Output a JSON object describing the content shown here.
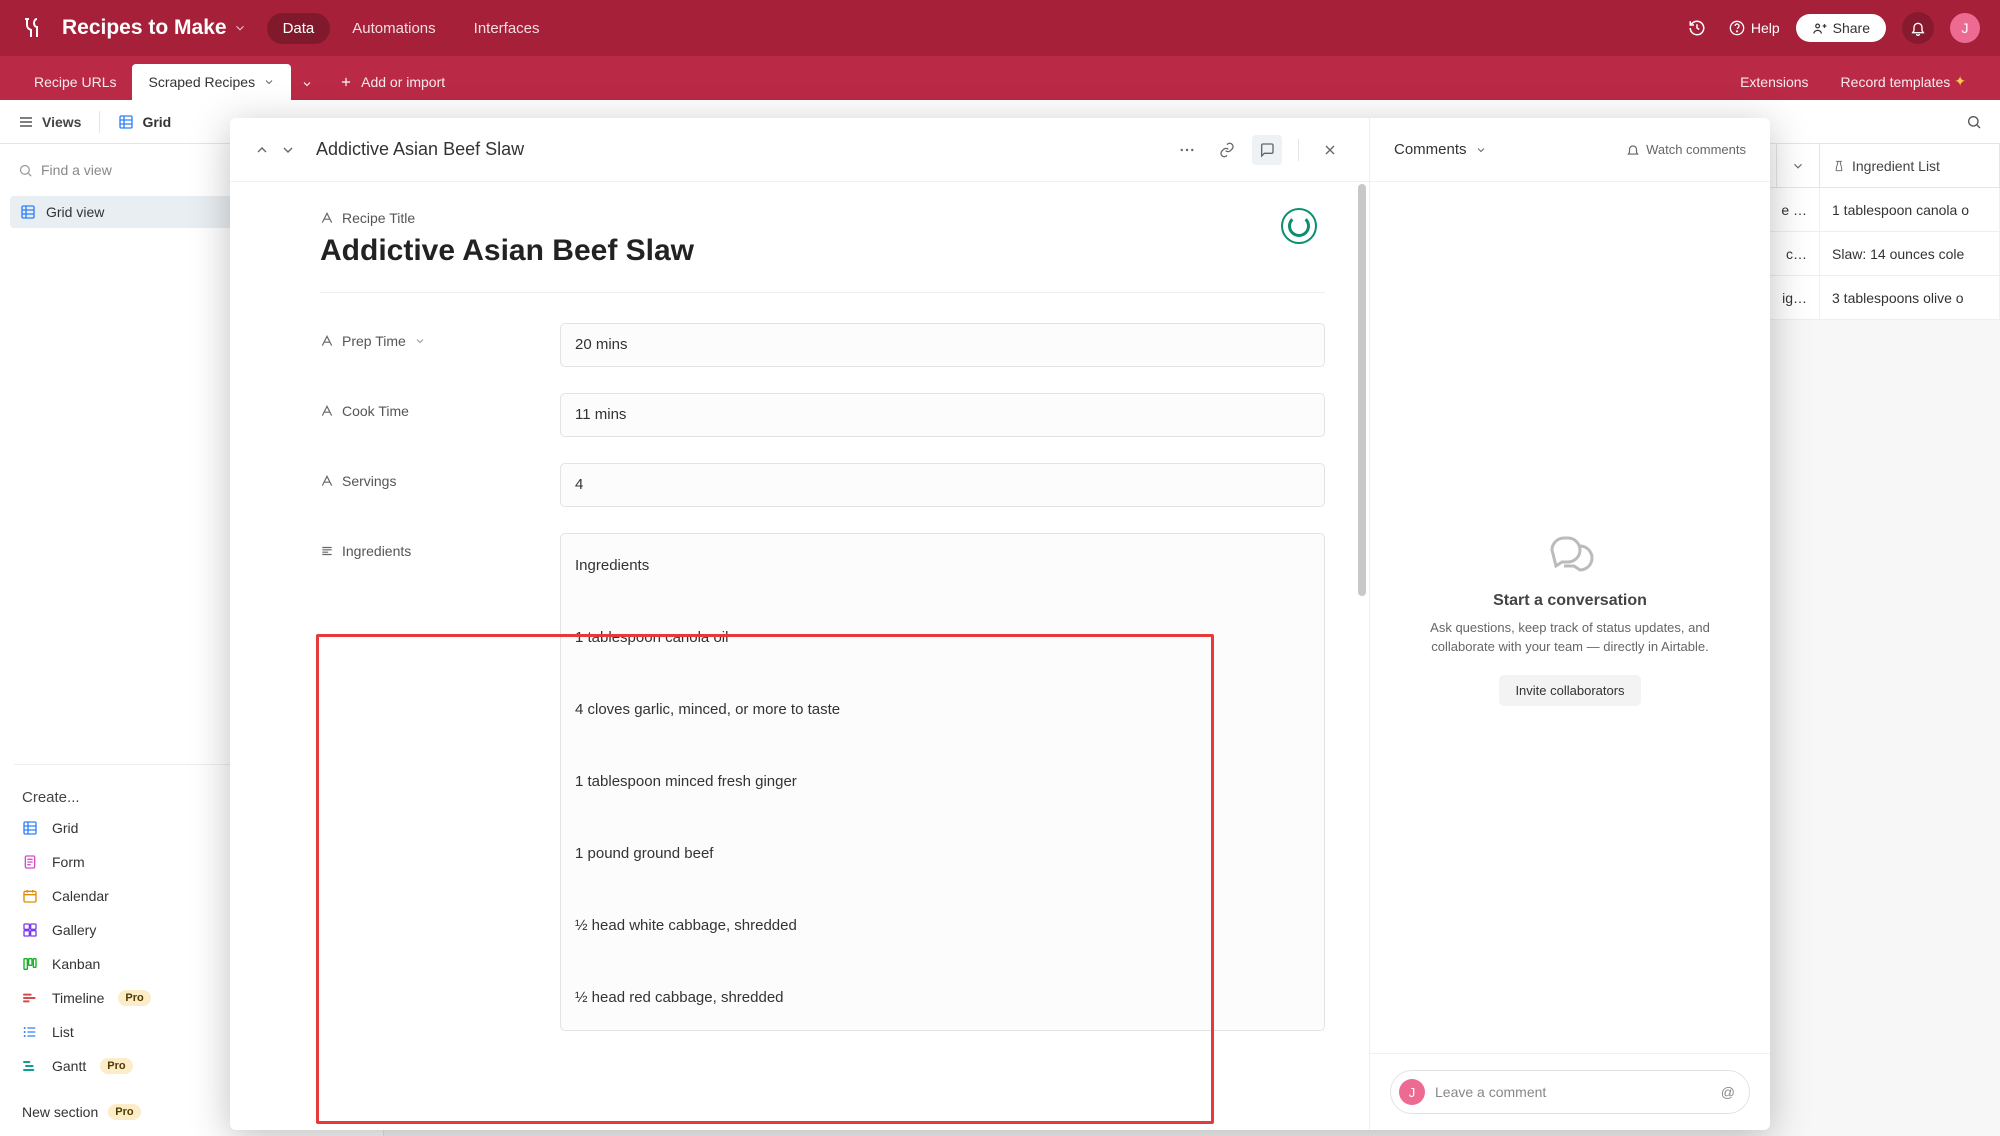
{
  "topbar": {
    "base_title": "Recipes to Make",
    "tabs": [
      "Data",
      "Automations",
      "Interfaces"
    ],
    "active_tab": 0,
    "help": "Help",
    "share": "Share",
    "avatar_initial": "J"
  },
  "tabbar": {
    "tables": [
      "Recipe URLs",
      "Scraped Recipes"
    ],
    "active_table": 1,
    "add_or_import": "Add or import",
    "extensions": "Extensions",
    "record_templates": "Record templates"
  },
  "toolbar": {
    "views": "Views",
    "grid": "Grid"
  },
  "left_panel": {
    "find_placeholder": "Find a view",
    "grid_view": "Grid view",
    "create_label": "Create...",
    "create_items": [
      {
        "label": "Grid",
        "icon": "grid",
        "color": "#2d7ff9"
      },
      {
        "label": "Form",
        "icon": "form",
        "color": "#d54ac6"
      },
      {
        "label": "Calendar",
        "icon": "calendar",
        "color": "#e08d00"
      },
      {
        "label": "Gallery",
        "icon": "gallery",
        "color": "#7c39ed"
      },
      {
        "label": "Kanban",
        "icon": "kanban",
        "color": "#11af22"
      },
      {
        "label": "Timeline",
        "icon": "timeline",
        "color": "#d54a4a",
        "pro": true
      },
      {
        "label": "List",
        "icon": "list",
        "color": "#2d7ff9"
      },
      {
        "label": "Gantt",
        "icon": "gantt",
        "color": "#0f9f8f",
        "pro": true
      }
    ],
    "new_section": "New section",
    "new_section_pro": true,
    "pro_label": "Pro"
  },
  "grid": {
    "column_header": "Ingredient List",
    "rows": [
      {
        "c0": "e …",
        "c1": "1 tablespoon canola o"
      },
      {
        "c0": "c…",
        "c1": "Slaw: 14 ounces cole"
      },
      {
        "c0": "ig…",
        "c1": "3 tablespoons olive o"
      }
    ]
  },
  "modal": {
    "header_title": "Addictive Asian Beef Slaw",
    "field_labels": {
      "recipe_title": "Recipe Title",
      "prep_time": "Prep Time",
      "cook_time": "Cook Time",
      "servings": "Servings",
      "ingredients": "Ingredients"
    },
    "values": {
      "recipe_title": "Addictive Asian Beef Slaw",
      "prep_time": "20 mins",
      "cook_time": "11 mins",
      "servings": "4",
      "ingredients": "Ingredients\n\n1 tablespoon canola oil\n\n4 cloves garlic, minced, or more to taste\n\n1 tablespoon minced fresh ginger\n\n1 pound ground beef\n\n½ head white cabbage, shredded\n\n½ head red cabbage, shredded"
    }
  },
  "comments": {
    "header": "Comments",
    "watch": "Watch comments",
    "empty_title": "Start a conversation",
    "empty_desc": "Ask questions, keep track of status updates, and collaborate with your team — directly in Airtable.",
    "invite": "Invite collaborators",
    "placeholder": "Leave a comment",
    "avatar_initial": "J"
  }
}
